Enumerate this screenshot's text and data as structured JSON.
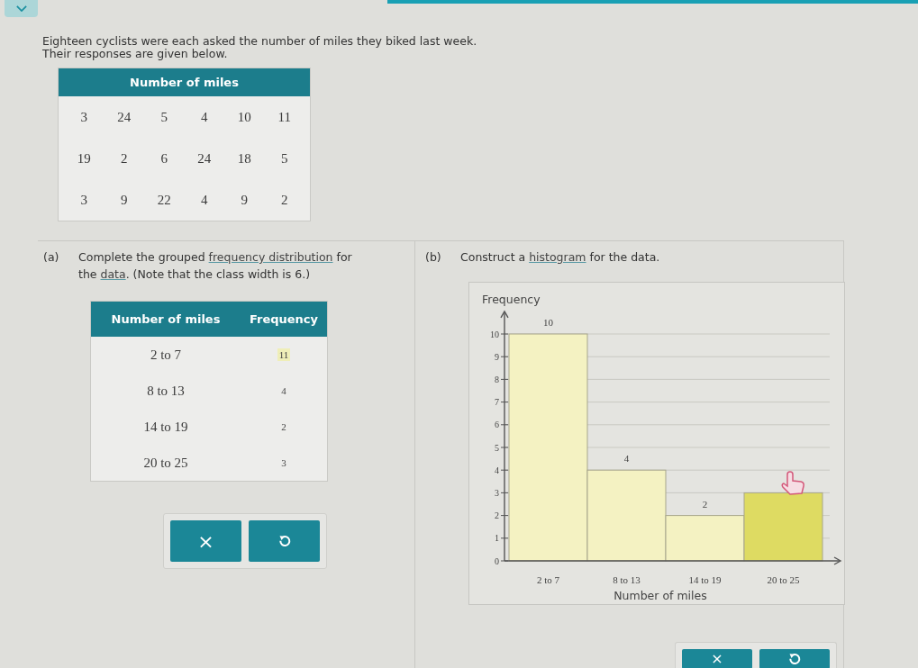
{
  "toggle": {
    "expanded": false
  },
  "question": {
    "lines": [
      "Eighteen cyclists were each asked the number of miles they biked last week.",
      "Their responses are given below."
    ]
  },
  "data_table": {
    "title": "Number of miles",
    "rows": [
      [
        "3",
        "24",
        "5",
        "4",
        "10",
        "11"
      ],
      [
        "19",
        "2",
        "6",
        "24",
        "18",
        "5"
      ],
      [
        "3",
        "9",
        "22",
        "4",
        "9",
        "2"
      ]
    ]
  },
  "part_a": {
    "label": "(a)",
    "prompt": [
      {
        "text": "Complete the grouped "
      },
      {
        "text": "frequency distribution",
        "kind": "link"
      },
      {
        "text": " for the "
      },
      {
        "text": "data",
        "kind": "link"
      },
      {
        "text": ". (Note that the class width is 6.)"
      }
    ],
    "frequency_table": {
      "columns": [
        "Number of miles",
        "Frequency"
      ],
      "rows": [
        {
          "class": "2 to 7",
          "frequency": "11",
          "highlighted": true
        },
        {
          "class": "8 to 13",
          "frequency": "4",
          "highlighted": false
        },
        {
          "class": "14 to 19",
          "frequency": "2",
          "highlighted": false
        },
        {
          "class": "20 to 25",
          "frequency": "3",
          "highlighted": false
        }
      ]
    },
    "buttons": [
      {
        "kind": "clear",
        "label": "×"
      },
      {
        "kind": "undo"
      }
    ]
  },
  "part_b": {
    "label": "(b)",
    "prompt": [
      {
        "text": "Construct a "
      },
      {
        "text": "histogram",
        "kind": "link"
      },
      {
        "text": " for the data."
      }
    ],
    "chart_data": {
      "type": "bar",
      "ylabel": "Frequency",
      "xlabel": "Number of miles",
      "categories": [
        "2 to 7",
        "8 to 13",
        "14 to 19",
        "20 to 25"
      ],
      "values": [
        10,
        4,
        2,
        3
      ],
      "colors": [
        "#f4f2c2",
        "#f4f2c2",
        "#f4f2c2",
        "#dedb62"
      ],
      "ylim": [
        0,
        11
      ],
      "yticks": [
        0,
        1,
        2,
        3,
        4,
        5,
        6,
        7,
        8,
        9,
        10
      ],
      "value_labels": [
        "10",
        "4",
        "2",
        null
      ],
      "grid": true
    },
    "buttons": [
      {
        "kind": "clear",
        "label": "×"
      },
      {
        "kind": "undo"
      }
    ]
  }
}
